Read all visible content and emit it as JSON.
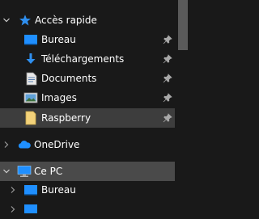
{
  "quick_access": {
    "label": "Accès rapide",
    "items": [
      {
        "label": "Bureau",
        "icon": "desktop-icon",
        "pinned": true
      },
      {
        "label": "Téléchargements",
        "icon": "download-icon",
        "pinned": true
      },
      {
        "label": "Documents",
        "icon": "document-icon",
        "pinned": true
      },
      {
        "label": "Images",
        "icon": "images-icon",
        "pinned": true
      },
      {
        "label": "Raspberry",
        "icon": "folder-icon",
        "pinned": true
      }
    ]
  },
  "onedrive": {
    "label": "OneDrive"
  },
  "this_pc": {
    "label": "Ce PC",
    "children": [
      {
        "label": "Bureau",
        "icon": "desktop-icon"
      }
    ]
  },
  "colors": {
    "background": "#191919",
    "selection": "#3d3d3d",
    "accent": "#0078d7"
  }
}
